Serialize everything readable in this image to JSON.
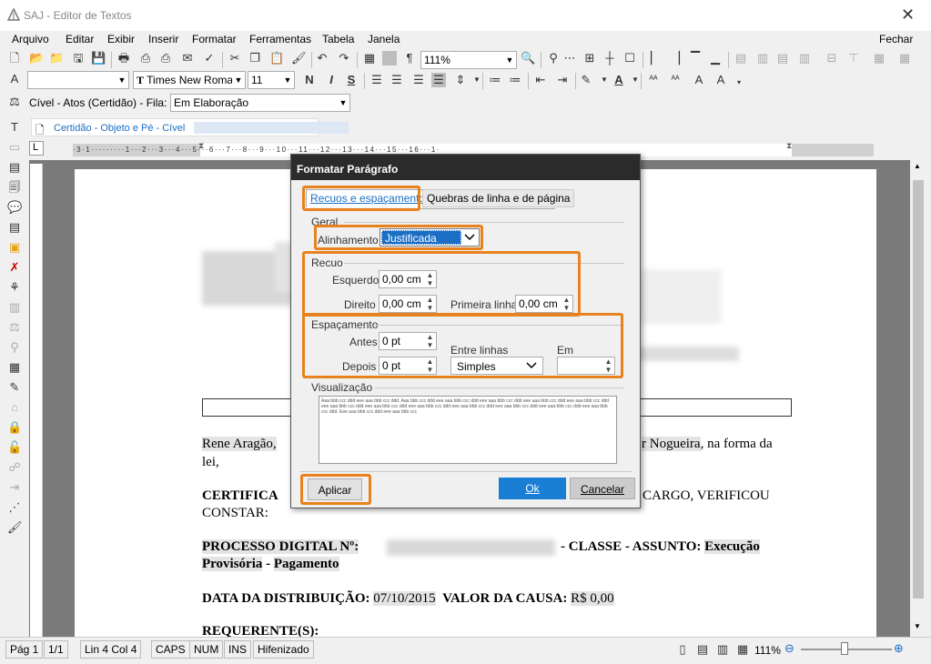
{
  "window": {
    "title": "SAJ - Editor de Textos",
    "close": "✕"
  },
  "menu": [
    "Arquivo",
    "Editar",
    "Exibir",
    "Inserir",
    "Formatar",
    "Ferramentas",
    "Tabela",
    "Janela"
  ],
  "menu_right": "Fechar",
  "toolbar1": {
    "zoom": "111%"
  },
  "toolbar2": {
    "font": "Times New Roman",
    "size": "11",
    "bold": "N",
    "italic": "I",
    "underline": "S"
  },
  "toolbar3": {
    "category": "Cível - Atos (Certidão) - Fila:",
    "queue": "Em Elaboração"
  },
  "doc_tab": "Certidão - Objeto e Pé - Cível",
  "ruler": {
    "marks": [
      "3",
      "1",
      "1",
      "2",
      "3",
      "4",
      "5",
      "6",
      "7",
      "8",
      "9",
      "10",
      "11",
      "12",
      "13",
      "14",
      "15",
      "16",
      "1"
    ]
  },
  "document": {
    "p1_start": "Rene Aragão, ",
    "p1_mid": "r Nogueira",
    "p1_end": ", na forma da",
    "p1_line2": "lei,",
    "certifica": "CERTIFICA",
    "certifica_right": "CARGO, VERIFICOU",
    "constar": "CONSTAR:",
    "processo_label": "PROCESSO DIGITAL Nº:",
    "classe": "- CLASSE - ASSUNTO:",
    "execucao": "Execução",
    "provisoria": "Provisória",
    "dash": " - ",
    "pagamento": "Pagamento",
    "data_label": "DATA DA DISTRIBUIÇÃO:",
    "data_value": "07/10/2015",
    "valor_label": "VALOR DA CAUSA:",
    "valor_value": "R$ 0,00",
    "requerente": "REQUERENTE(S):"
  },
  "dialog": {
    "title": "Formatar Parágrafo",
    "tab1": "Recuos e espaçamento",
    "tab2": "Quebras de linha e de página",
    "geral": "Geral",
    "alinhamento_label": "Alinhamento",
    "alinhamento_value": "Justificada",
    "recuo": "Recuo",
    "esquerdo_label": "Esquerdo",
    "esquerdo_value": "0,00 cm",
    "direito_label": "Direito",
    "direito_value": "0,00 cm",
    "primeira_label": "Primeira linha",
    "primeira_value": "0,00 cm",
    "espacamento": "Espaçamento",
    "antes_label": "Antes",
    "antes_value": "0 pt",
    "depois_label": "Depois",
    "depois_value": "0 pt",
    "entre_label": "Entre linhas",
    "entre_value": "Simples",
    "em_label": "Em",
    "em_value": "",
    "visualizacao": "Visualização",
    "preview_text": "Aaa bbb ccc ddd eee aaa bbb ccc ddd. Aaa bbb ccc ddd eee aaa bbb ccc ddd eee aaa bbb ccc ddd eee aaa bbb ccc ddd eee aaa bbb ccc ddd eee aaa bbb ccc ddd eee aaa bbb ccc ddd eee aaa bbb ccc ddd eee aaa bbb ccc ddd eee aaa bbb ccc ddd eee aaa bbb ccc ddd eee aaa bbb ccc ddd. Eee aaa bbb ccc ddd eee aaa bbb ccc",
    "aplicar": "Aplicar",
    "ok": "Ok",
    "cancelar": "Cancelar"
  },
  "status": {
    "pag": "Pág 1",
    "of": "1/1",
    "lin": "Lin 4  Col 4",
    "caps": "CAPS",
    "num": "NUM",
    "ins": "INS",
    "hif": "Hifenizado",
    "zoom": "111%"
  },
  "colors": {
    "accent": "#e8821e",
    "ok_button": "#1a7fd4",
    "title_bar": "#2b2b2b"
  }
}
